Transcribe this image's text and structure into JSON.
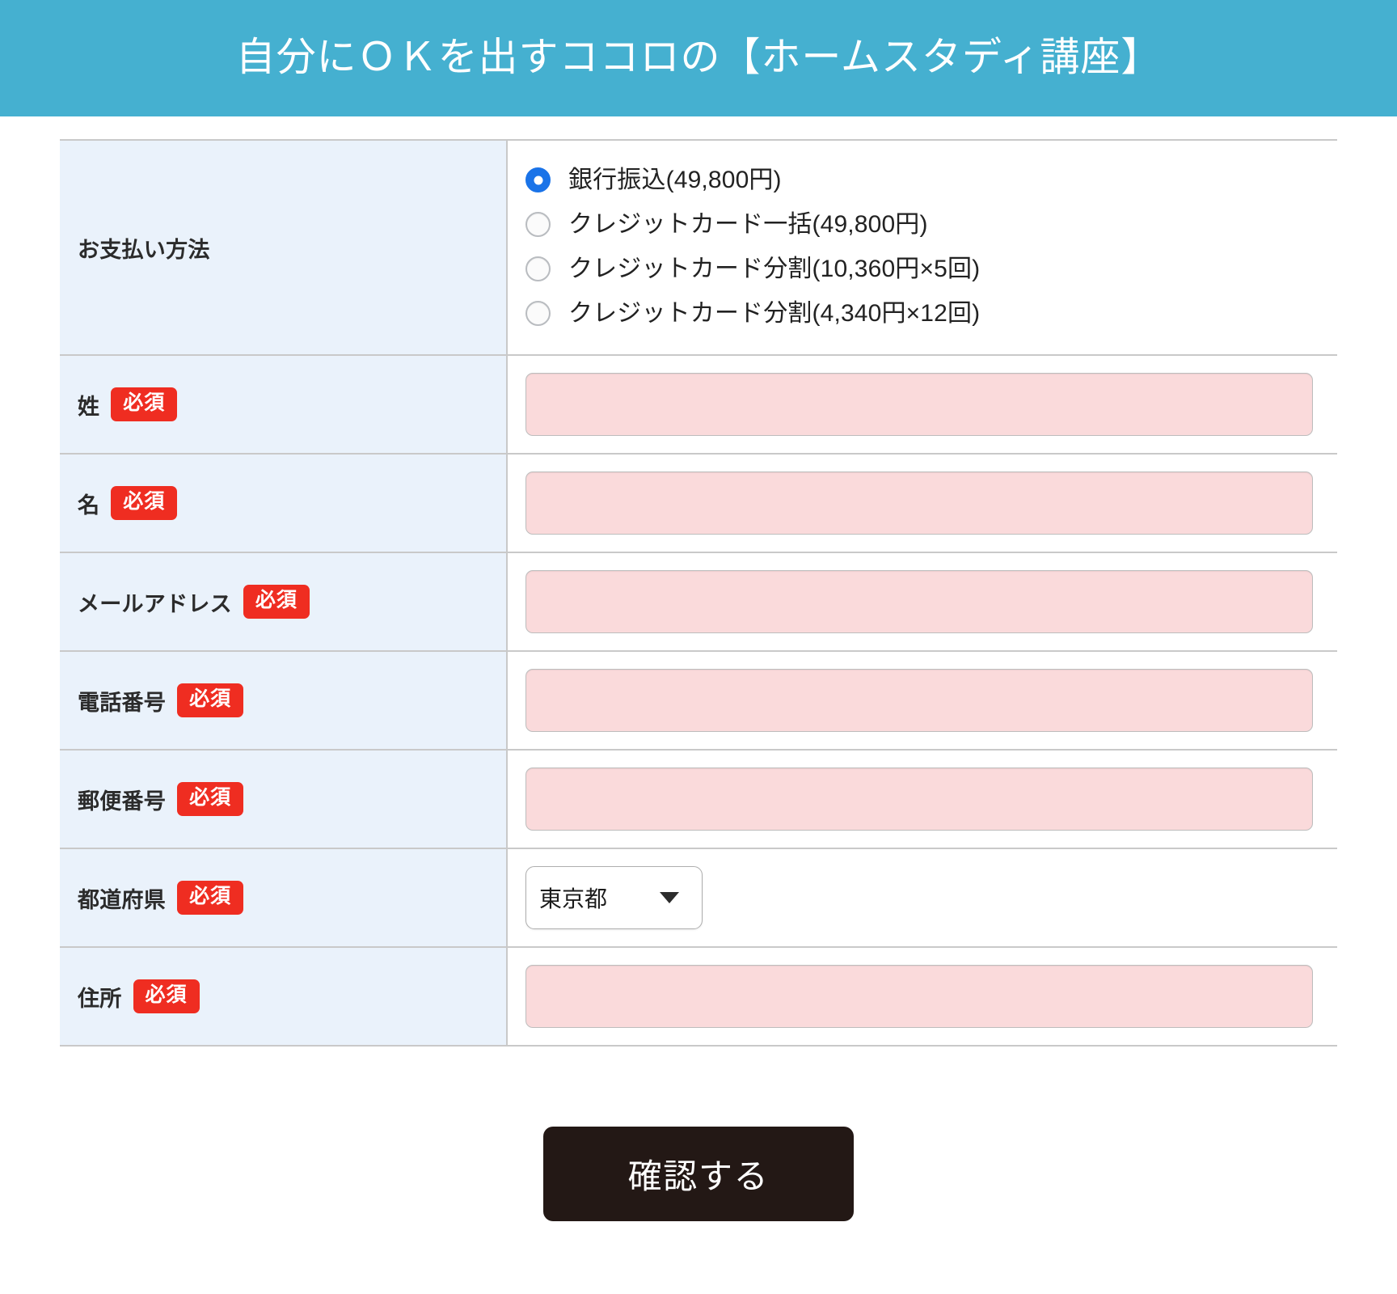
{
  "header": {
    "title": "自分にＯＫを出すココロの【ホームスタディ講座】",
    "background_color": "#45b0d0",
    "text_color": "#ffffff"
  },
  "badges": {
    "required_label": "必須",
    "required_bg": "#ef2d21",
    "required_text_color": "#ffffff"
  },
  "form": {
    "payment": {
      "label": "お支払い方法",
      "options": [
        {
          "label": "銀行振込(49,800円)",
          "selected": true
        },
        {
          "label": "クレジットカード一括(49,800円)",
          "selected": false
        },
        {
          "label": "クレジットカード分割(10,360円×5回)",
          "selected": false
        },
        {
          "label": "クレジットカード分割(4,340円×12回)",
          "selected": false
        }
      ],
      "selected_color": "#1a73e8"
    },
    "last_name": {
      "label": "姓",
      "required": "必須",
      "value": "",
      "placeholder": ""
    },
    "first_name": {
      "label": "名",
      "required": "必須",
      "value": "",
      "placeholder": ""
    },
    "email": {
      "label": "メールアドレス",
      "required": "必須",
      "value": "",
      "placeholder": ""
    },
    "phone": {
      "label": "電話番号",
      "required": "必須",
      "value": "",
      "placeholder": ""
    },
    "postal_code": {
      "label": "郵便番号",
      "required": "必須",
      "value": "",
      "placeholder": ""
    },
    "prefecture": {
      "label": "都道府県",
      "required": "必須",
      "value": "東京都",
      "options": [
        "東京都"
      ]
    },
    "address": {
      "label": "住所",
      "required": "必須",
      "value": "",
      "placeholder": ""
    },
    "input_bg": "#fadadb"
  },
  "submit": {
    "label": "確認する",
    "bg": "#231815",
    "text_color": "#ffffff"
  }
}
